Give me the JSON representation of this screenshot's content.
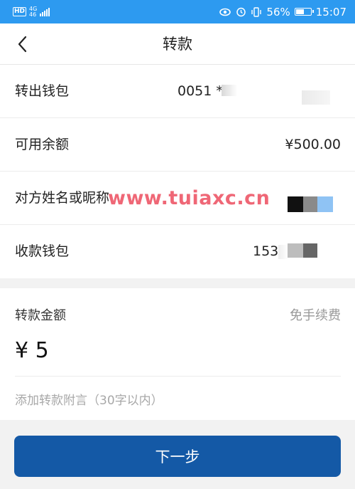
{
  "status_bar": {
    "hd": "HD",
    "network": "4G",
    "network_sub": "46",
    "battery_percent": "56%",
    "battery_level": 0.56,
    "time": "15:07",
    "icons": [
      "eye-icon",
      "alarm-icon",
      "vibrate-icon",
      "battery-icon"
    ]
  },
  "nav": {
    "back_icon": "chevron-left-icon",
    "title": "转款"
  },
  "rows": [
    {
      "label": "转出钱包",
      "value": "0051 **"
    },
    {
      "label": "可用余额",
      "value": "¥500.00"
    },
    {
      "label": "对方姓名或昵称",
      "value": ""
    },
    {
      "label": "收款钱包",
      "value": "153"
    }
  ],
  "watermark": "www.tuiaxc.cn",
  "amount": {
    "label": "转款金额",
    "fee": "免手续费",
    "value": "¥ 5",
    "memo_placeholder": "添加转款附言（30字以内）"
  },
  "next_button": "下一步",
  "colors": {
    "status_bar": "#2d9af0",
    "primary_button": "#1459a6",
    "watermark": "#eb3c50"
  }
}
